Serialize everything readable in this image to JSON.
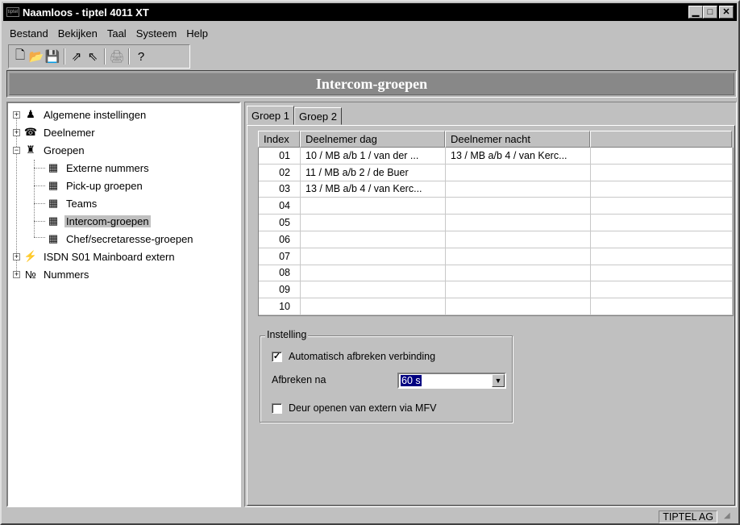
{
  "window": {
    "app_icon": "tiptel",
    "title": "Naamloos - tiptel 4011 XT",
    "minimize": "▁",
    "maximize": "□",
    "close": "✕"
  },
  "menu": {
    "bestand": "Bestand",
    "bekijken": "Bekijken",
    "taal": "Taal",
    "systeem": "Systeem",
    "help": "Help"
  },
  "toolbar": {
    "new": "🗋",
    "open": "📂",
    "save": "💾",
    "send": "⇗",
    "receive": "⇖",
    "print": "🖨",
    "help": "?"
  },
  "banner": {
    "title": "Intercom-groepen"
  },
  "tree": {
    "expand": "+",
    "collapse": "−",
    "items": [
      {
        "label": "Algemene instellingen",
        "icon": "globe-person-icon",
        "glyph": "♟"
      },
      {
        "label": "Deelnemer",
        "icon": "phone-icon",
        "glyph": "☎"
      },
      {
        "label": "Groepen",
        "icon": "group-icon",
        "glyph": "♜"
      },
      {
        "label": "Externe nummers",
        "icon": "board-icon",
        "glyph": "▦"
      },
      {
        "label": "Pick-up groepen",
        "icon": "board-icon",
        "glyph": "▦"
      },
      {
        "label": "Teams",
        "icon": "board-icon",
        "glyph": "▦"
      },
      {
        "label": "Intercom-groepen",
        "icon": "board-icon",
        "glyph": "▦"
      },
      {
        "label": "Chef/secretaresse-groepen",
        "icon": "board-icon",
        "glyph": "▦"
      },
      {
        "label": "ISDN S01 Mainboard extern",
        "icon": "isdn-plug-icon",
        "glyph": "⚡"
      },
      {
        "label": "Nummers",
        "icon": "numbers-icon",
        "glyph": "№"
      }
    ]
  },
  "tabs": {
    "tab1": "Groep 1",
    "tab2": "Groep 2"
  },
  "grid": {
    "headers": {
      "index": "Index",
      "day": "Deelnemer dag",
      "night": "Deelnemer nacht"
    },
    "rows": [
      {
        "index": "01",
        "day": "10 / MB a/b 1 / van der ...",
        "night": "13 / MB a/b 4 / van Kerc..."
      },
      {
        "index": "02",
        "day": "11 / MB a/b 2 / de Buer",
        "night": ""
      },
      {
        "index": "03",
        "day": "13 / MB a/b 4 / van Kerc...",
        "night": ""
      },
      {
        "index": "04",
        "day": "",
        "night": ""
      },
      {
        "index": "05",
        "day": "",
        "night": ""
      },
      {
        "index": "06",
        "day": "",
        "night": ""
      },
      {
        "index": "07",
        "day": "",
        "night": ""
      },
      {
        "index": "08",
        "day": "",
        "night": ""
      },
      {
        "index": "09",
        "day": "",
        "night": ""
      },
      {
        "index": "10",
        "day": "",
        "night": ""
      }
    ]
  },
  "settings": {
    "title": "Instelling",
    "auto_disconnect": {
      "label": "Automatisch afbreken verbinding",
      "checked": true,
      "mark": "✓"
    },
    "disconnect_after": {
      "label": "Afbreken na",
      "value": "60 s",
      "arrow": "▼"
    },
    "door_open": {
      "label": "Deur openen van extern via MFV",
      "checked": false,
      "mark": ""
    }
  },
  "status": {
    "company": "TIPTEL AG",
    "grip": "◢"
  }
}
